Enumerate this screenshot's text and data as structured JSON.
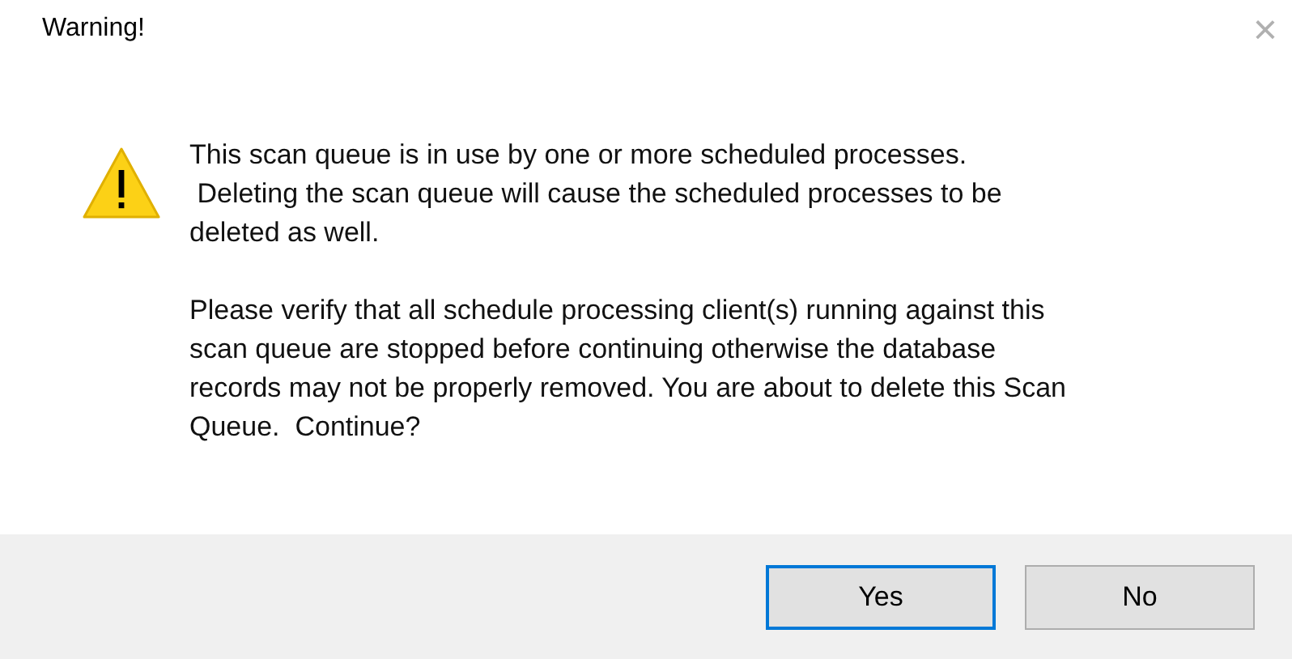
{
  "window": {
    "title": "Warning!",
    "close": "×"
  },
  "message": {
    "kind": "warning",
    "paragraphs": [
      "This scan queue is in use by one or more scheduled processes.\n Deleting the scan queue will cause the scheduled processes to be\ndeleted as well.",
      "Please verify that all schedule processing client(s) running against this\nscan queue are stopped before continuing otherwise the database\nrecords may not be properly removed. You are about to delete this Scan\nQueue.  Continue?"
    ]
  },
  "buttons": [
    {
      "label": "Yes",
      "default": true
    },
    {
      "label": "No",
      "default": false
    }
  ]
}
